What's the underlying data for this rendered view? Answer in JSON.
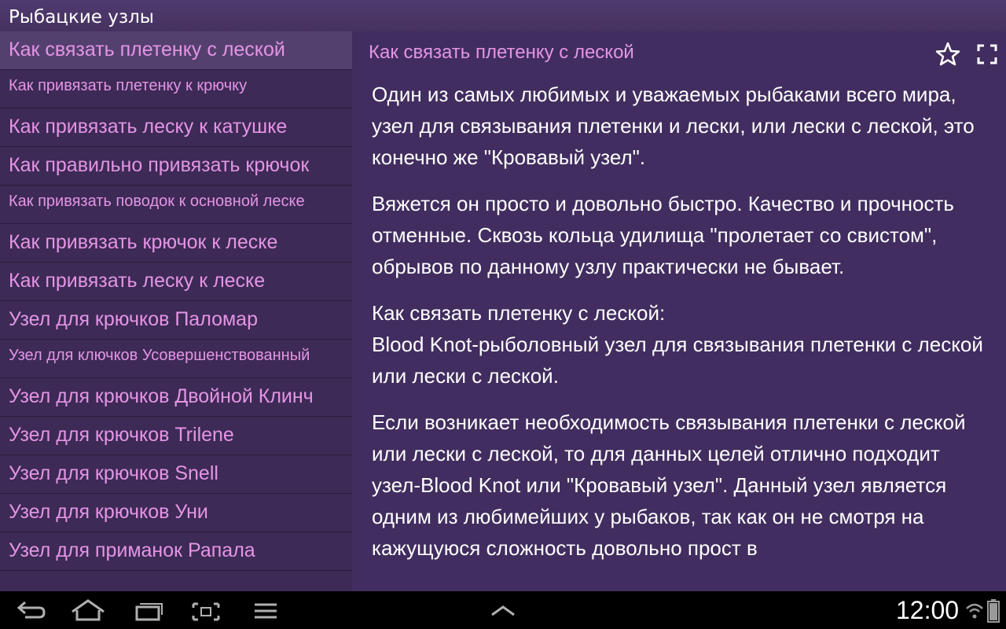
{
  "app": {
    "title": "Рыбацкие узлы"
  },
  "sidebar": {
    "items": [
      {
        "label": "Как связать плетенку с леской",
        "selected": true
      },
      {
        "label": "Как привязать плетенку к крючку",
        "small": true
      },
      {
        "label": "Как привязать леску к катушке"
      },
      {
        "label": "Как правильно привязать крючок"
      },
      {
        "label": "Как привязать поводок к основной леске",
        "small": true
      },
      {
        "label": "Как привязать крючок к леске"
      },
      {
        "label": "Как привязать леску к леске"
      },
      {
        "label": "Узел для крючков Паломар"
      },
      {
        "label": "Узел для ключков Усовершенствованный",
        "small": true
      },
      {
        "label": "Узел для крючков Двойной Клинч"
      },
      {
        "label": "Узел для крючков Trilene"
      },
      {
        "label": "Узел для крючков Snell"
      },
      {
        "label": "Узел для крючков Уни"
      },
      {
        "label": "Узел для приманок Рапала"
      }
    ]
  },
  "content": {
    "header": "Как связать плетенку с леской",
    "star_icon": "star-outline-icon",
    "fullscreen_icon": "fullscreen-icon",
    "paragraphs": [
      "Один из самых любимых и уважаемых рыбаками всего мира, узел для связывания плетенки и лески, или лески с леской, это конечно же \"Кровавый узел\".",
      "Вяжется он просто и довольно быстро. Качество и прочность отменные. Сквозь кольца удилища \"пролетает со свистом\", обрывов по данному узлу практически не бывает.",
      "Как связать плетенку с леской:",
      "Blood Knot-рыболовный узел для связывания плетенки с леской или лески с леской.",
      "Если возникает необходимость связывания плетенки с леской или лески с леской, то для данных целей отлично подходит узел-Blood Knot или \"Кровавый узел\". Данный узел является одним из любимейших у рыбаков, так как он не смотря на кажущуюся сложность довольно прост в"
    ]
  },
  "navbar": {
    "back_icon": "back-icon",
    "home_icon": "home-icon",
    "recent_icon": "recent-apps-icon",
    "screenshot_icon": "screenshot-icon",
    "menu_icon": "menu-icon",
    "up_icon": "chevron-up-icon",
    "clock": "12:00",
    "wifi_icon": "wifi-icon",
    "battery_icon": "battery-icon"
  },
  "colors": {
    "accent": "#e495e4",
    "background": "#412d5f",
    "sidebar": "#3d2a56",
    "selected": "#54406e"
  }
}
